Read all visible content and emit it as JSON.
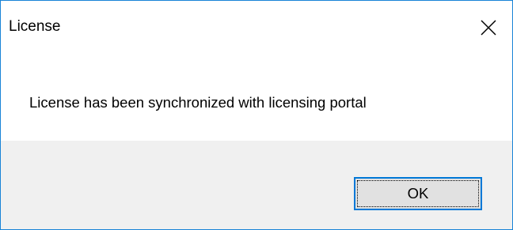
{
  "window": {
    "title": "License",
    "close_icon": "close-icon"
  },
  "message": {
    "text": "License has been synchronized with licensing portal"
  },
  "buttons": {
    "ok_label": "OK"
  },
  "colors": {
    "border_accent": "#1883d7",
    "footer_background": "#f0f0f0",
    "button_background": "#e1e1e1",
    "button_focus_border": "#0078d7"
  }
}
